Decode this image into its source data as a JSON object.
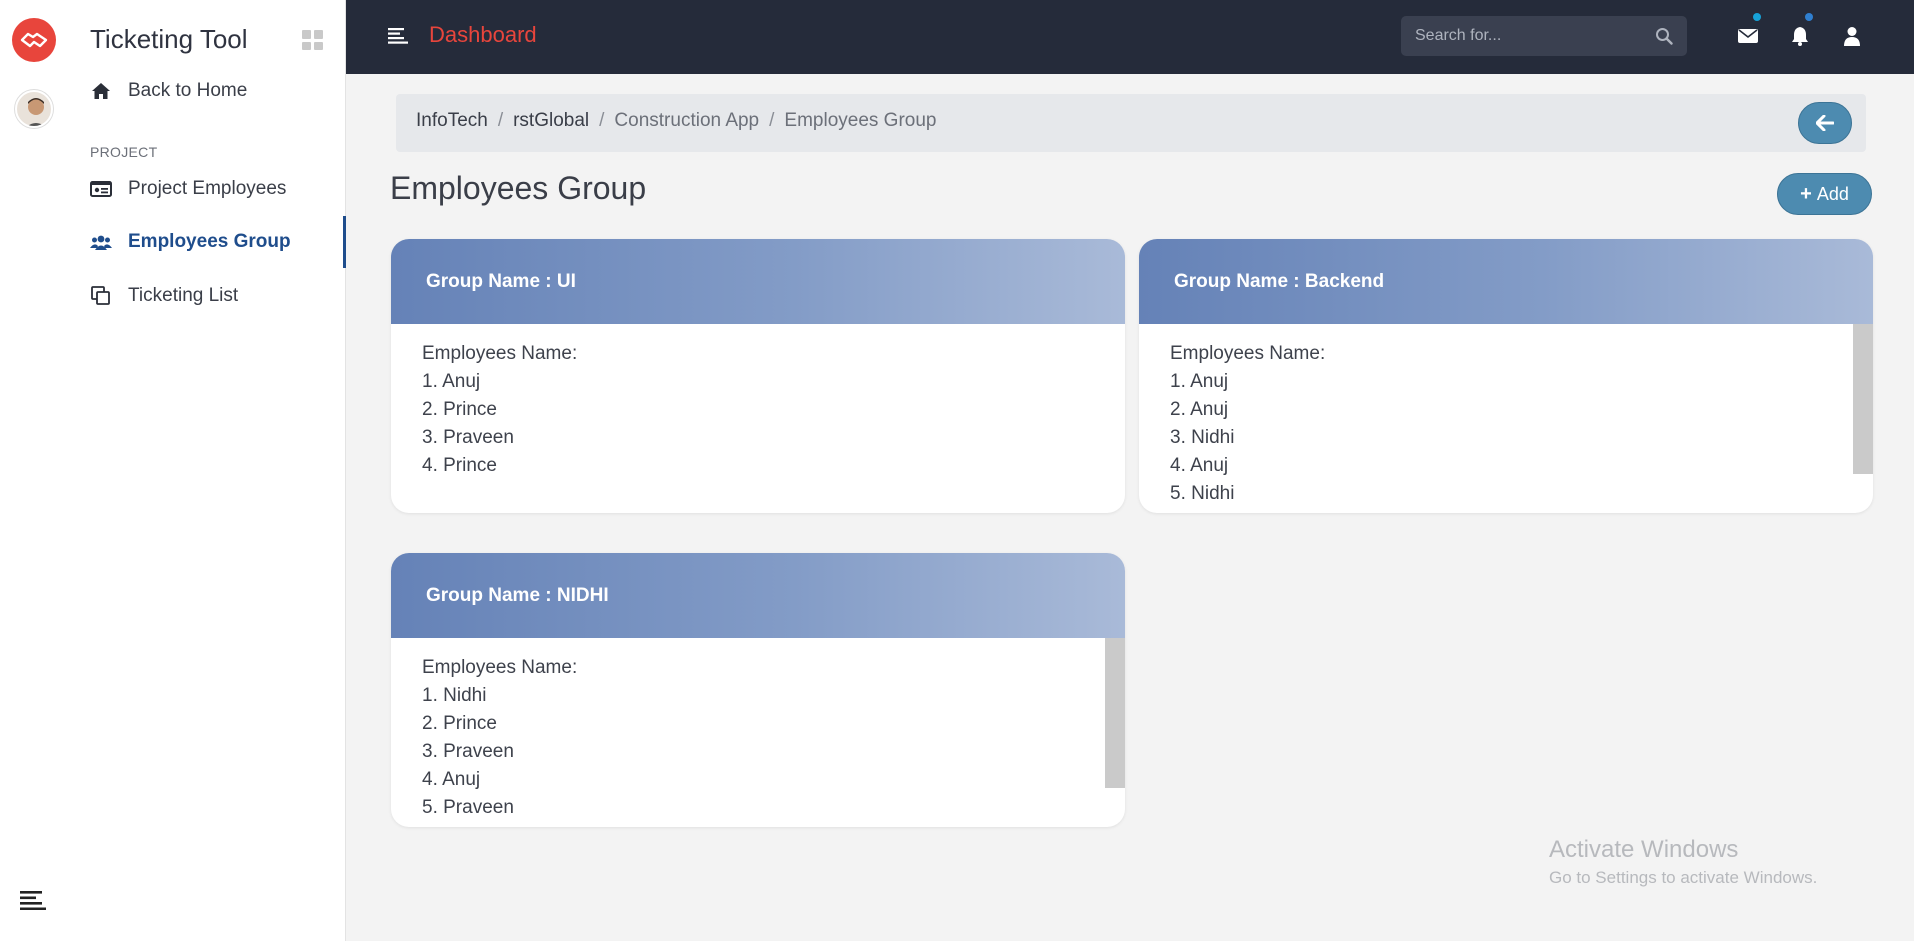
{
  "app": {
    "title": "Ticketing Tool"
  },
  "header": {
    "title": "Dashboard",
    "search_placeholder": "Search for..."
  },
  "sidebar": {
    "back_home": "Back to Home",
    "section": "PROJECT",
    "items": [
      {
        "label": "Project Employees"
      },
      {
        "label": "Employees Group"
      },
      {
        "label": "Ticketing List"
      }
    ]
  },
  "breadcrumb": [
    "InfoTech",
    "rstGlobal",
    "Construction App",
    "Employees Group"
  ],
  "page": {
    "title": "Employees Group",
    "add_label": "Add"
  },
  "groups": [
    {
      "title": "Group Name : UI",
      "members_label": "Employees Name:",
      "members": [
        "1. Anuj",
        "2. Prince",
        "3. Praveen",
        "4. Prince"
      ]
    },
    {
      "title": "Group Name : Backend",
      "members_label": "Employees Name:",
      "members": [
        "1. Anuj",
        "2. Anuj",
        "3. Nidhi",
        "4. Anuj",
        "5. Nidhi"
      ]
    },
    {
      "title": "Group Name : NIDHI",
      "members_label": "Employees Name:",
      "members": [
        "1. Nidhi",
        "2. Prince",
        "3. Praveen",
        "4. Anuj",
        "5. Praveen"
      ]
    }
  ],
  "watermark": {
    "line1": "Activate Windows",
    "line2": "Go to Settings to activate Windows."
  },
  "colors": {
    "accent": "#e8453c",
    "topbar": "#252b3a",
    "primary_button": "#4d8bb0",
    "active_nav": "#1f4d8c",
    "mail_dot": "#17a2d8",
    "bell_dot": "#2f7fd0"
  }
}
